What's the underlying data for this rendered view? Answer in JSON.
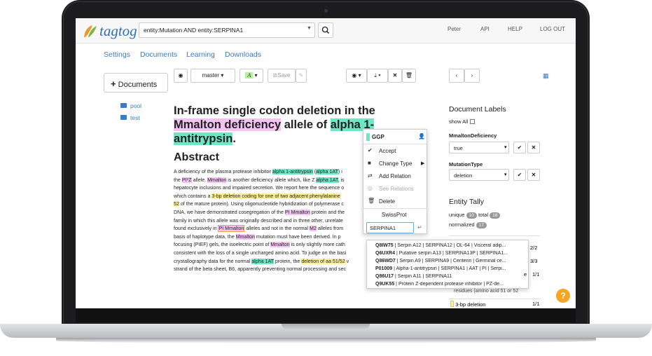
{
  "header": {
    "logo_text": "tagtog",
    "search_value": "entity:Mutation AND entity:SERPINA1",
    "user": "Peter",
    "api": "API",
    "help": "HELP",
    "logout": "LOG OUT"
  },
  "nav": [
    "Settings",
    "Documents",
    "Learning",
    "Downloads"
  ],
  "sidebar": {
    "documents_button": "Documents",
    "folders": [
      "pool",
      "test"
    ]
  },
  "toolbar": {
    "branch": "master",
    "save": "Save"
  },
  "document": {
    "title_parts": [
      {
        "text": "In-frame single codon deletion in the ",
        "hl": ""
      },
      {
        "text": "Mmalton deficiency",
        "hl": "pink"
      },
      {
        "text": " allele of ",
        "hl": ""
      },
      {
        "text": "alpha 1-antitrypsin",
        "hl": "teal"
      },
      {
        "text": ".",
        "hl": ""
      }
    ],
    "abstract_heading": "Abstract",
    "abstract_lines": [
      [
        {
          "t": "A deficiency of the plasma protease inhibitor ",
          "h": ""
        },
        {
          "t": "alpha 1-antitrypsin",
          "h": "teal"
        },
        {
          "t": " (",
          "h": ""
        },
        {
          "t": "alpha 1AT",
          "h": "teal"
        },
        {
          "t": ") i",
          "h": ""
        }
      ],
      [
        {
          "t": "the ",
          "h": ""
        },
        {
          "t": "PI*Z",
          "h": "pink"
        },
        {
          "t": " allele. ",
          "h": ""
        },
        {
          "t": "Mmalton",
          "h": "pink"
        },
        {
          "t": " is another deficiency allele which, like Z ",
          "h": ""
        },
        {
          "t": "alpha 1AT",
          "h": "teal"
        },
        {
          "t": ", is",
          "h": ""
        }
      ],
      [
        {
          "t": "hepatocyte inclusions and impaired secretion. We report here the sequence o",
          "h": ""
        }
      ],
      [
        {
          "t": "which contains a ",
          "h": ""
        },
        {
          "t": "3-bp deletion coding for one of two adjacent phenylalanine",
          "h": "yellow"
        }
      ],
      [
        {
          "t": "52",
          "h": "yellow"
        },
        {
          "t": " of the mature protein). Using oligonucleotide hybridization of polymerase c",
          "h": ""
        }
      ],
      [
        {
          "t": "DNA, we have demonstrated cosegregation of the ",
          "h": ""
        },
        {
          "t": "PI Mmalton",
          "h": "pink"
        },
        {
          "t": " protein and the",
          "h": ""
        }
      ],
      [
        {
          "t": "family in which this allele was originally described and in three other, unrelate",
          "h": ""
        }
      ],
      [
        {
          "t": "found exclusively in ",
          "h": ""
        },
        {
          "t": "PI Mmalton",
          "h": "pinkbox"
        },
        {
          "t": " alleles and not in the normal ",
          "h": ""
        },
        {
          "t": "M2",
          "h": "pink"
        },
        {
          "t": " alleles from",
          "h": ""
        }
      ],
      [
        {
          "t": "basis of haplotype data, the ",
          "h": ""
        },
        {
          "t": "Mmalton",
          "h": "pink"
        },
        {
          "t": " mutation must have been derived. In p",
          "h": ""
        }
      ],
      [
        {
          "t": "focusing (PIEF) gels, the isoelectric point of ",
          "h": ""
        },
        {
          "t": "Mmalton",
          "h": "pink"
        },
        {
          "t": " is only slightly more cath",
          "h": ""
        }
      ],
      [
        {
          "t": "consistent with the loss of a single uncharged amino acid. To judge on the basi",
          "h": ""
        }
      ],
      [
        {
          "t": "crystallography data for the normal ",
          "h": ""
        },
        {
          "t": "alpha 1AT",
          "h": "teal"
        },
        {
          "t": " protein, the ",
          "h": ""
        },
        {
          "t": "deletion of aa 51/52",
          "h": "yellow"
        },
        {
          "t": " v",
          "h": ""
        }
      ],
      [
        {
          "t": "strand of the beta sheet, B6, apparently preventing normal processing and sec",
          "h": ""
        }
      ]
    ]
  },
  "context_menu": {
    "type_label": "GGP",
    "items": [
      "Accept",
      "Change Type",
      "Add Relation",
      "See Relations",
      "Delete"
    ],
    "db_label": "SwissProt",
    "lookup_value": "SERPINA1"
  },
  "autocomplete": [
    {
      "id": "Q8IW75",
      "desc": " | Serpin A12 | SERPINA12 | OL-64 | Visceral adip..."
    },
    {
      "id": "Q6UXR4",
      "desc": " | Putative serpin A13 | SERPINA13P | SERPINA1..."
    },
    {
      "id": "Q86WD7",
      "desc": " | Serpin A9 | SERPINA9 | Centerin | Germinal ce..."
    },
    {
      "id": "P01009",
      "desc": " | Alpha-1-antitrypsin | SERPINA1 | AAT | PI | Serpi..."
    },
    {
      "id": "Q86U17",
      "desc": " | Serpin A11 | SERPINA11"
    },
    {
      "id": "Q9UK55",
      "desc": " | Protein Z-dependent protease inhibitor | PZ-de..."
    }
  ],
  "labels_panel": {
    "heading": "Document Labels",
    "show_all": "show All",
    "fields": [
      {
        "name": "MmaltonDeficiency",
        "value": "true"
      },
      {
        "name": "MutationType",
        "value": "deletion"
      }
    ]
  },
  "tally": {
    "heading": "Entity Tally",
    "unique_label": "unique",
    "unique_count": "10",
    "total_label": "total",
    "total_count": "18",
    "normalized_label": "normalized",
    "normalized_count": "17",
    "partial_rows": [
      {
        "label": "",
        "count": "2/2"
      },
      {
        "label": "",
        "count": "3/3"
      },
      {
        "label": "e",
        "count": "1/1"
      },
      {
        "label": "residues (amino acid 51 or 52",
        "count": ""
      },
      {
        "label": "3-bp deletion",
        "count": "1/1"
      }
    ]
  },
  "colors": {
    "brand": "#2f6fb4",
    "highlight_pink": "#f3c4f1",
    "highlight_teal": "#6ee7c4",
    "highlight_yellow": "#fcef9a",
    "help": "#f5a623"
  }
}
